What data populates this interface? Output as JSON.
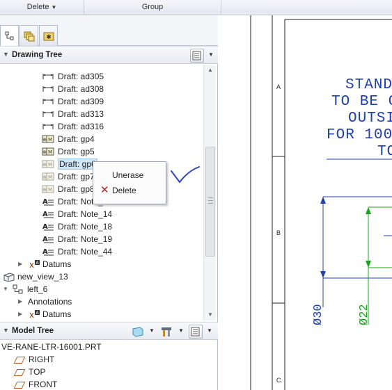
{
  "ribbon": {
    "delete_label": "Delete",
    "group_label": "Group"
  },
  "drawing_tree": {
    "title": "Drawing Tree",
    "items": [
      {
        "label": "Draft: ad305",
        "icon": "dimension-icon"
      },
      {
        "label": "Draft: ad308",
        "icon": "dimension-icon"
      },
      {
        "label": "Draft: ad309",
        "icon": "dimension-icon"
      },
      {
        "label": "Draft: ad313",
        "icon": "dimension-icon"
      },
      {
        "label": "Draft: ad316",
        "icon": "dimension-icon"
      },
      {
        "label": "Draft: gp4",
        "icon": "geometric-tolerance-icon"
      },
      {
        "label": "Draft: gp5",
        "icon": "geometric-tolerance-icon"
      },
      {
        "label": "Draft: gp6",
        "icon": "geometric-tolerance-icon",
        "selected": true
      },
      {
        "label": "Draft: gp7",
        "icon": "geometric-tolerance-icon"
      },
      {
        "label": "Draft: gp8",
        "icon": "geometric-tolerance-icon"
      },
      {
        "label": "Draft: Note_",
        "icon": "note-icon"
      },
      {
        "label": "Draft: Note_14",
        "icon": "note-icon"
      },
      {
        "label": "Draft: Note_18",
        "icon": "note-icon"
      },
      {
        "label": "Draft: Note_19",
        "icon": "note-icon"
      },
      {
        "label": "Draft: Note_44",
        "icon": "note-icon"
      }
    ],
    "datums_1": "Datums",
    "new_view": "new_view_13",
    "left_view": "left_6",
    "annotations": "Annotations",
    "datums_2": "Datums"
  },
  "context_menu": {
    "unerase_label": "Unerase",
    "delete_label": "Delete"
  },
  "model_tree": {
    "title": "Model Tree",
    "part_name": "VE-RANE-LTR-16001.PRT",
    "items": [
      "RIGHT",
      "TOP",
      "FRONT"
    ]
  },
  "canvas": {
    "note_lines": [
      "STAND",
      "TO BE C",
      "OUTSI",
      "FOR 100",
      "TO"
    ],
    "zone_letters": [
      "A",
      "B",
      "C"
    ],
    "dimension_1": "Ø30",
    "dimension_2": "Ø22"
  },
  "colors": {
    "annotation_blue": "#1d3fb5",
    "dimension_green": "#1aa41a",
    "selection_bg": "#cfe6f8",
    "delete_red": "#c41a1a"
  }
}
